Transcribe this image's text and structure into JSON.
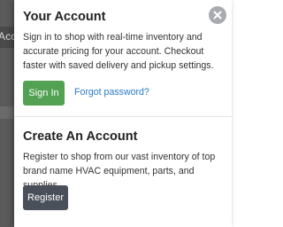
{
  "background": {
    "edge_text": "Acc"
  },
  "account": {
    "title": "Your Account",
    "description": "Sign in to shop with real-time inventory and accurate pricing for your account. Checkout faster with saved delivery and pickup settings.",
    "signin_label": "Sign In",
    "forgot_label": "Forgot password?"
  },
  "create": {
    "title": "Create An Account",
    "description": "Register to shop from our vast inventory of top brand name HVAC equipment, parts, and supplies.",
    "register_label": "Register"
  },
  "colors": {
    "signin_button": "#53a153",
    "register_button": "#4a5059",
    "link": "#2a7ac8",
    "close_button": "#a9abb0"
  },
  "icons": {
    "close": "close-icon"
  }
}
